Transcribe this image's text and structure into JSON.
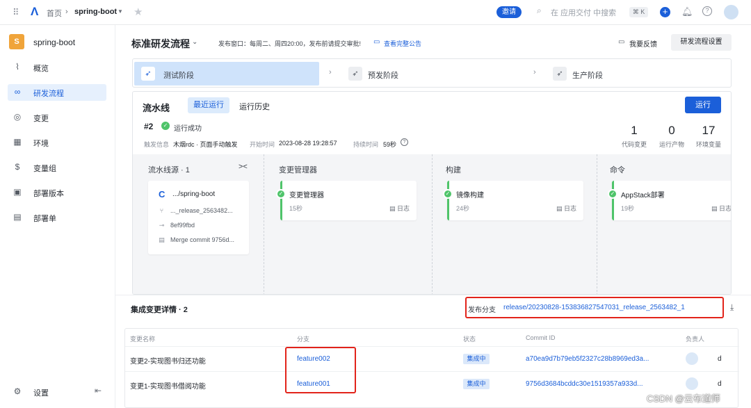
{
  "topbar": {
    "home": "首页",
    "project": "spring-boot",
    "invite": "邀请",
    "search_placeholder": "在 应用交付 中搜索",
    "shortcut": "⌘ K"
  },
  "sidebar": {
    "project_initial": "S",
    "project_name": "spring-boot",
    "items": [
      {
        "label": "概览",
        "icon": "chart-line-icon"
      },
      {
        "label": "研发流程",
        "icon": "infinity-icon"
      },
      {
        "label": "变更",
        "icon": "change-icon"
      },
      {
        "label": "环境",
        "icon": "grid-icon"
      },
      {
        "label": "变量组",
        "icon": "dollar-icon"
      },
      {
        "label": "部署版本",
        "icon": "package-icon"
      },
      {
        "label": "部署单",
        "icon": "document-icon"
      }
    ],
    "settings": "设置"
  },
  "header": {
    "title": "标准研发流程",
    "notice": "发布窗口：每周二、周四20:00，发布前请提交审批!",
    "notice_link": "查看完整公告",
    "feedback": "我要反馈",
    "settings_button": "研发流程设置"
  },
  "stages": [
    "测试阶段",
    "预发阶段",
    "生产阶段"
  ],
  "pipeline": {
    "title": "流水线",
    "tab_recent": "最近运行",
    "tab_history": "运行历史",
    "run_button": "运行",
    "run_id": "#2",
    "status": "运行成功",
    "trigger_label": "触发信息",
    "trigger_value": "木烟rdc · 页面手动触发",
    "start_label": "开始时间",
    "start_value": "2023-08-28 19:28:57",
    "duration_label": "持续时间",
    "duration_value": "59秒",
    "stats": [
      {
        "value": "1",
        "label": "代码变更"
      },
      {
        "value": "0",
        "label": "运行产物"
      },
      {
        "value": "17",
        "label": "环境变量"
      }
    ],
    "source_title": "流水线源 · 1",
    "source": {
      "repo": ".../spring-boot",
      "branch": "..._release_2563482...",
      "commit": "8ef99fbd",
      "message": "Merge commit 9756d..."
    },
    "columns": [
      {
        "title": "变更管理器",
        "job": "变更管理器",
        "time": "15秒",
        "log": "日志"
      },
      {
        "title": "构建",
        "job": "镜像构建",
        "time": "24秒",
        "log": "日志"
      },
      {
        "title": "命令",
        "job": "AppStack部署",
        "time": "19秒",
        "log": "日志"
      }
    ]
  },
  "details": {
    "title": "集成变更详情 · 2",
    "release_label": "发布分支",
    "release_branch": "release/20230828-153836827547031_release_2563482_1",
    "columns": [
      "变更名称",
      "分支",
      "状态",
      "Commit ID",
      "负责人"
    ],
    "rows": [
      {
        "name": "变更2-实现图书归还功能",
        "branch": "feature002",
        "status": "集成中",
        "commit": "a70ea9d7b79eb5f2327c28b8969ed3a...",
        "owner": "d"
      },
      {
        "name": "变更1-实现图书借阅功能",
        "branch": "feature001",
        "status": "集成中",
        "commit": "9756d3684bcddc30e1519357a933d...",
        "owner": "d"
      }
    ]
  },
  "watermark": "CSDN @云布道师",
  "colors": {
    "accent": "#1b5fd9",
    "success": "#4fc46a",
    "highlight": "#e2231a",
    "active_bg": "#e6f0fd"
  }
}
